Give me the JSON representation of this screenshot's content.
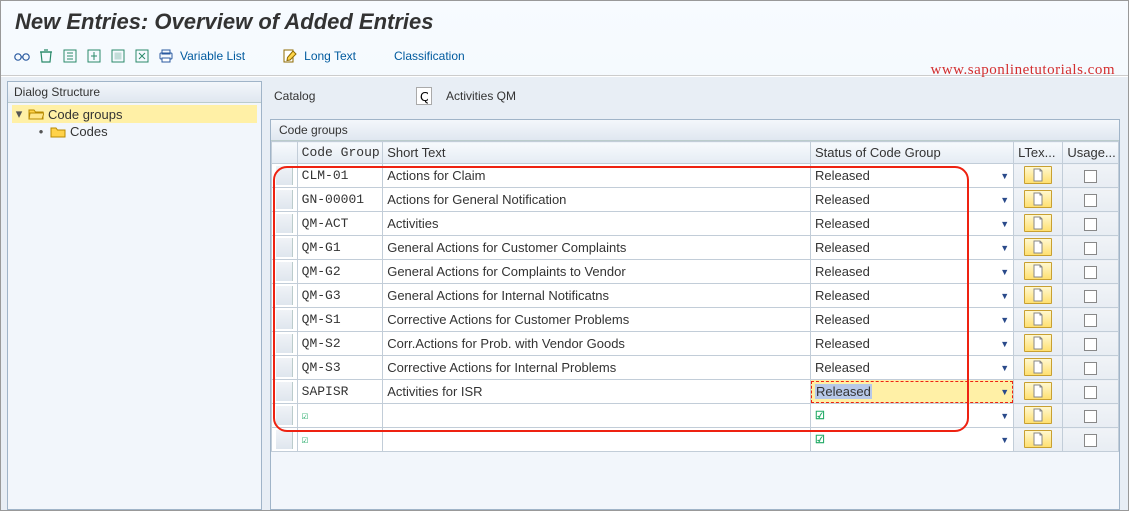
{
  "title": "New Entries: Overview of Added Entries",
  "watermark": "www.saponlinetutorials.com",
  "toolbar": {
    "variable_list": "Variable List",
    "long_text": "Long Text",
    "classification": "Classification"
  },
  "sidebar": {
    "header": "Dialog Structure",
    "items": [
      {
        "label": "Code groups",
        "selected": true,
        "expanded": true,
        "level": 0
      },
      {
        "label": "Codes",
        "selected": false,
        "expanded": false,
        "level": 1
      }
    ]
  },
  "catalog": {
    "label": "Catalog",
    "value": "Q",
    "desc": "Activities QM"
  },
  "grid": {
    "title": "Code groups",
    "columns": {
      "code": "Code Group",
      "short": "Short Text",
      "status": "Status of Code Group",
      "ltext": "LTex...",
      "usage": "Usage..."
    },
    "rows": [
      {
        "code": "CLM-01",
        "short": "Actions for Claim",
        "status": "Released"
      },
      {
        "code": "GN-00001",
        "short": "Actions for General Notification",
        "status": "Released"
      },
      {
        "code": "QM-ACT",
        "short": "Activities",
        "status": "Released"
      },
      {
        "code": "QM-G1",
        "short": "General Actions for Customer Complaints",
        "status": "Released"
      },
      {
        "code": "QM-G2",
        "short": "General Actions for Complaints to Vendor",
        "status": "Released"
      },
      {
        "code": "QM-G3",
        "short": "General Actions for Internal Notificatns",
        "status": "Released"
      },
      {
        "code": "QM-S1",
        "short": "Corrective Actions for Customer Problems",
        "status": "Released"
      },
      {
        "code": "QM-S2",
        "short": "Corr.Actions for Prob. with Vendor Goods",
        "status": "Released"
      },
      {
        "code": "QM-S3",
        "short": "Corrective Actions for Internal Problems",
        "status": "Released"
      },
      {
        "code": "SAPISR",
        "short": "Activities for ISR",
        "status": "Released",
        "status_selected": true
      }
    ],
    "empty_rows": 2
  }
}
